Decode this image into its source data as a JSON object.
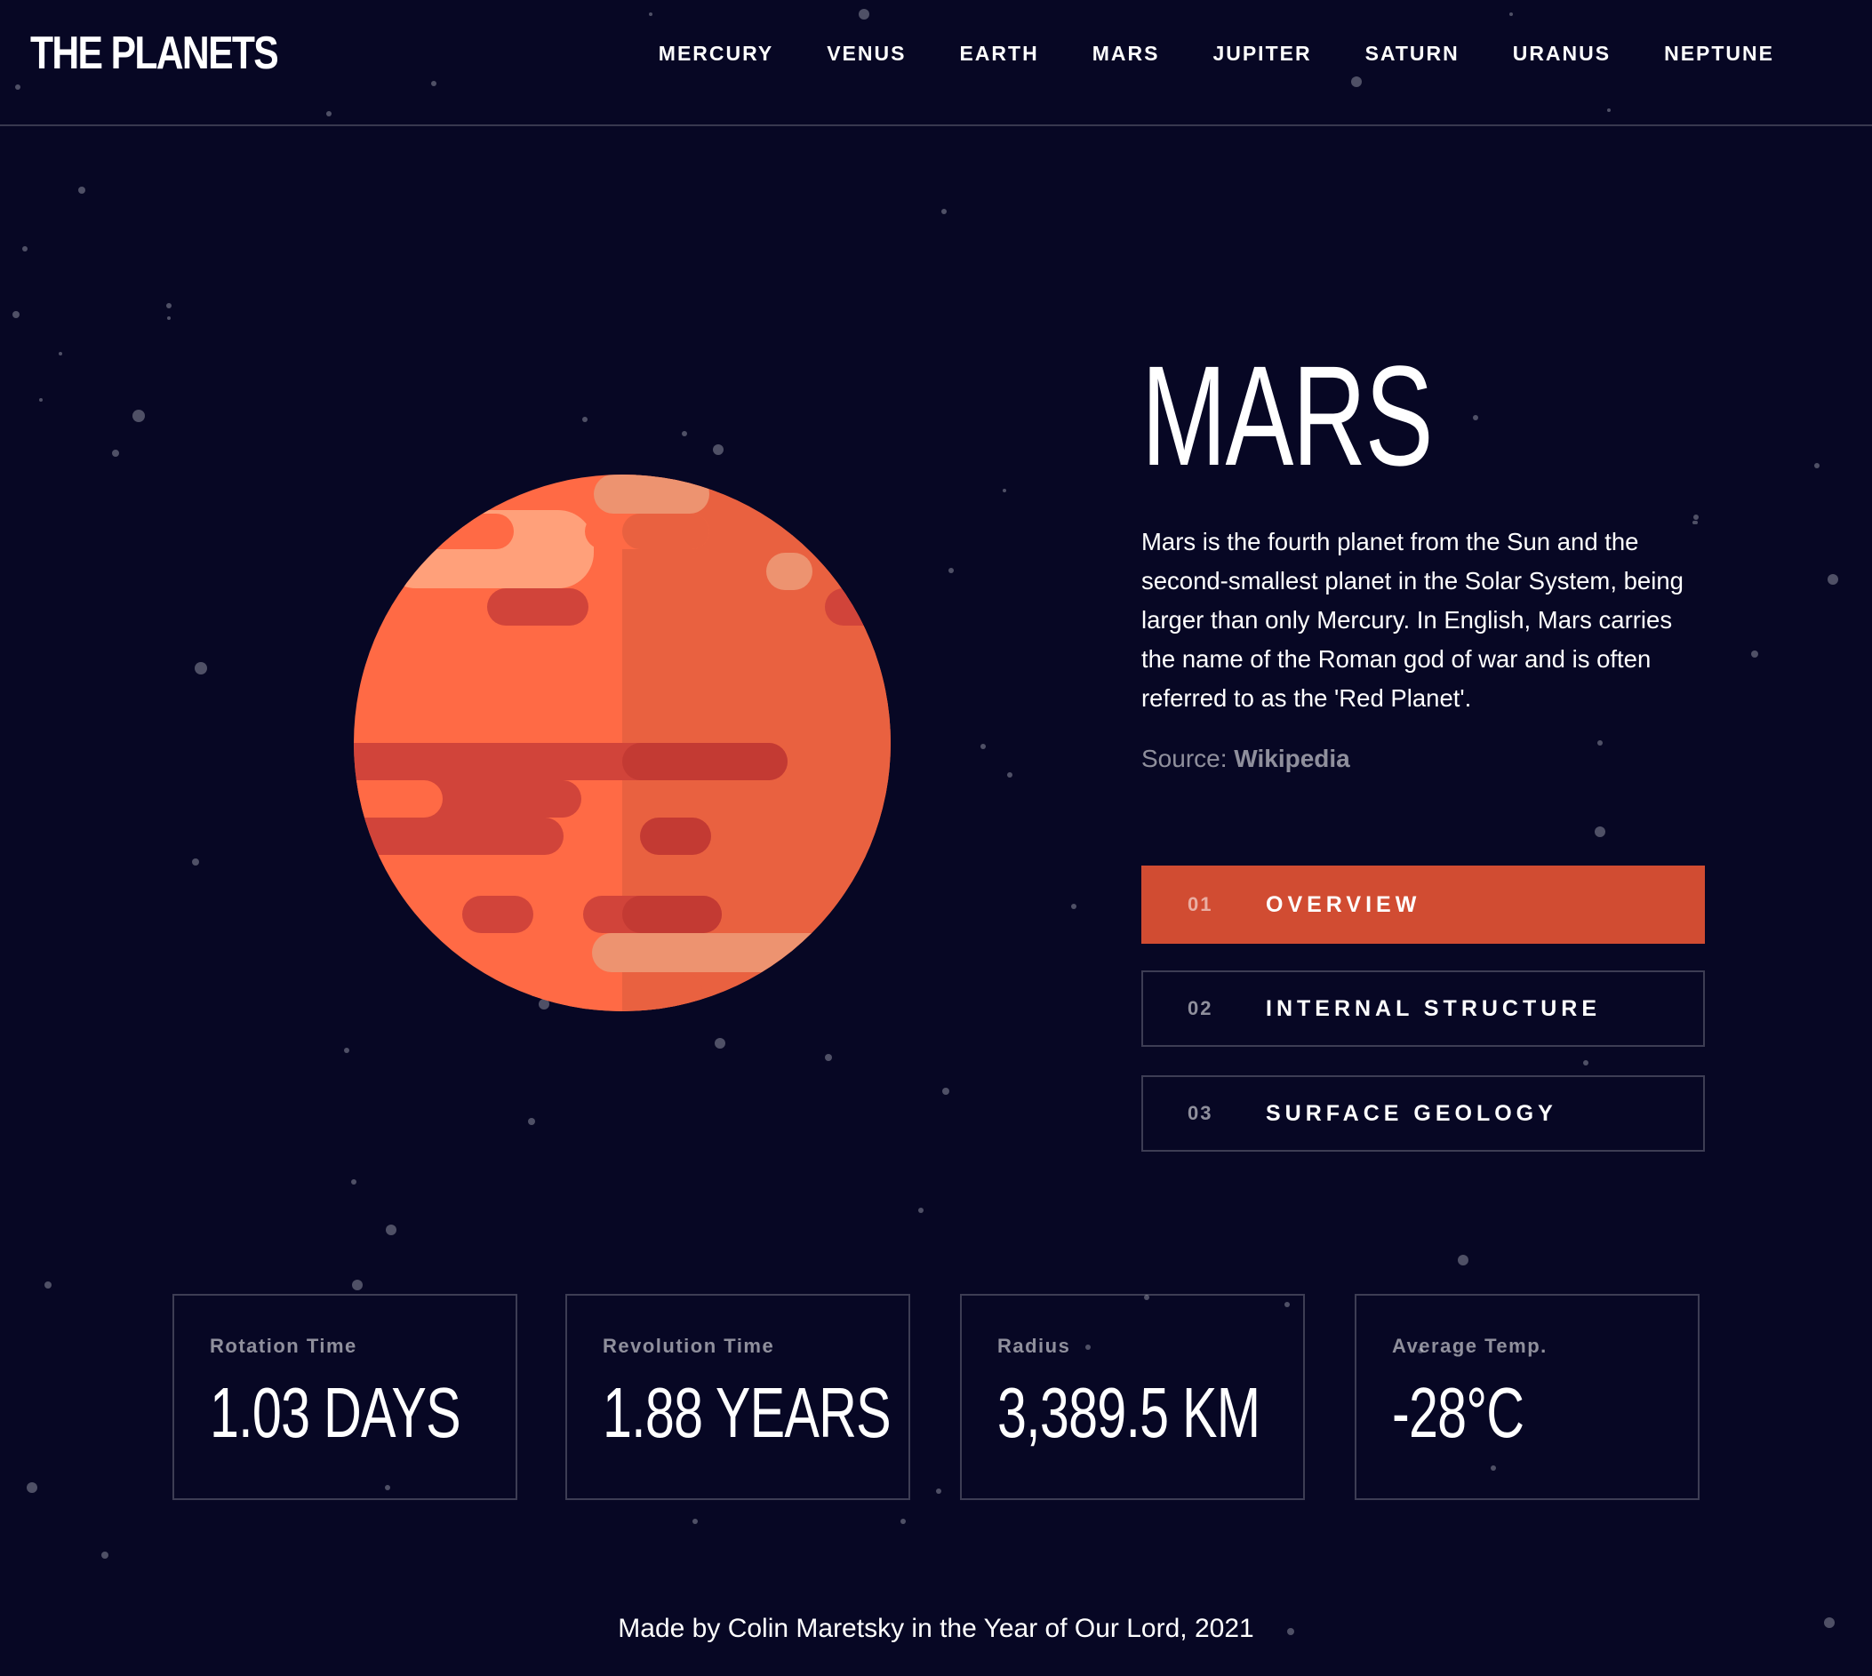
{
  "header": {
    "logo": "THE PLANETS",
    "nav": [
      "MERCURY",
      "VENUS",
      "EARTH",
      "MARS",
      "JUPITER",
      "SATURN",
      "URANUS",
      "NEPTUNE"
    ]
  },
  "planet": {
    "name": "MARS",
    "description": "Mars is the fourth planet from the Sun and the second-smallest planet in the Solar System, being larger than only Mercury. In English, Mars carries the name of the Roman god of war and is often referred to as the 'Red Planet'.",
    "source_label": "Source: ",
    "source_link": "Wikipedia",
    "icon": "mars-planet-illustration"
  },
  "tabs": [
    {
      "num": "01",
      "label": "OVERVIEW",
      "active": true
    },
    {
      "num": "02",
      "label": "INTERNAL STRUCTURE",
      "active": false
    },
    {
      "num": "03",
      "label": "SURFACE GEOLOGY",
      "active": false
    }
  ],
  "stats": [
    {
      "label": "Rotation Time",
      "value": "1.03 DAYS"
    },
    {
      "label": "Revolution Time",
      "value": "1.88 YEARS"
    },
    {
      "label": "Radius",
      "value": "3,389.5 KM"
    },
    {
      "label": "Average Temp.",
      "value": "-28°C"
    }
  ],
  "footer": "Made by Colin Maretsky in the Year of Our Lord, 2021",
  "colors": {
    "background": "#070724",
    "accent": "#D14C32",
    "planet_base": "#FF6A45",
    "planet_shade": "#E96140",
    "planet_light": "#FFA07A",
    "planet_dark": "#D1443A"
  }
}
